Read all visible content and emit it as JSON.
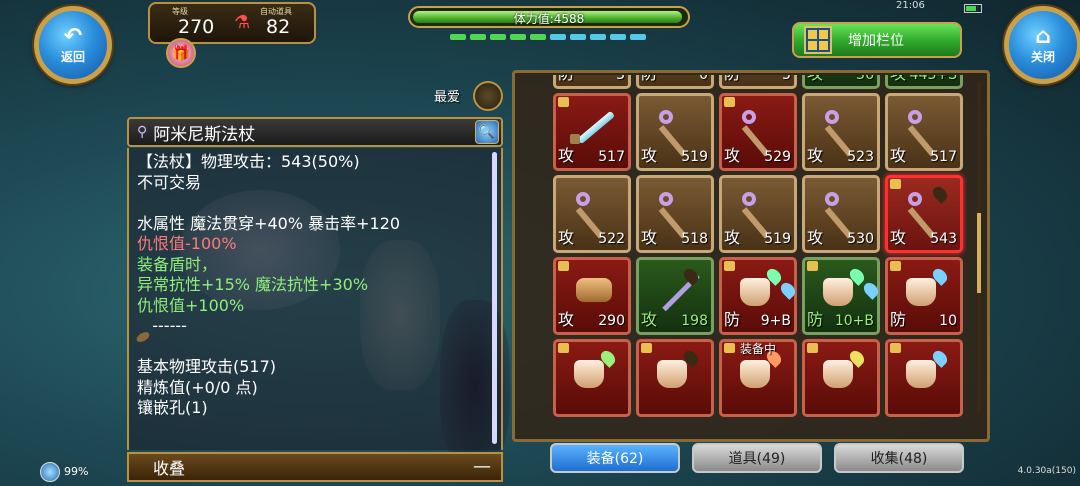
{
  "nav": {
    "back_label": "返回",
    "close_label": "关闭"
  },
  "status": {
    "level_label": "等级",
    "level_value": "270",
    "potion_label": "自动道具",
    "potion_value": "82"
  },
  "stamina": {
    "text": "体力值:4588",
    "fill_fraction": 0.99
  },
  "energy_segments": [
    "#53d651",
    "#53d651",
    "#53d651",
    "#53d651",
    "#53d651",
    "#55c9e6",
    "#55c9e6",
    "#55c9e6",
    "#55c9e6",
    "#55c9e6"
  ],
  "system": {
    "time": "21:06"
  },
  "add_slot": {
    "label": "增加栏位"
  },
  "favorite": {
    "label": "最爱"
  },
  "item": {
    "name": "阿米尼斯法杖",
    "details": [
      {
        "text": "【法杖】物理攻击：543(50%)",
        "color": "white"
      },
      {
        "text": "不可交易",
        "color": "white"
      },
      {
        "text": "",
        "color": "white"
      },
      {
        "text": "水属性 魔法贯穿+40% 暴击率+120",
        "color": "white"
      },
      {
        "text": "仇恨值-100%",
        "color": "red"
      },
      {
        "text": "装备盾时，",
        "color": "green"
      },
      {
        "text": "异常抗性+15% 魔法抗性+30%",
        "color": "green"
      },
      {
        "text": "仇恨值+100%",
        "color": "green"
      },
      {
        "text": "   ------",
        "color": "white"
      },
      {
        "text": "",
        "color": "white"
      },
      {
        "text": "基本物理攻击(517)",
        "color": "white"
      },
      {
        "text": "精炼值(+0/0 点)",
        "color": "white"
      },
      {
        "text": "镶嵌孔(1)",
        "color": "white"
      }
    ],
    "collapse_label": "收叠",
    "collapse_symbol": "—"
  },
  "inventory": {
    "slots": [
      {
        "type": "防",
        "value": "3",
        "style": "normal",
        "icon": "ring",
        "gems": [
          "#7ad0ff",
          "#d080ff"
        ],
        "locked": false
      },
      {
        "type": "防",
        "value": "0",
        "style": "normal",
        "icon": "ring",
        "gems": [
          "#7ad0ff",
          "#d080ff"
        ],
        "locked": false
      },
      {
        "type": "防",
        "value": "5",
        "style": "normal",
        "icon": "ring",
        "gems": [
          "#7ad0ff",
          "#d080ff"
        ],
        "locked": false
      },
      {
        "type": "攻",
        "value": "56",
        "style": "green",
        "icon": "sword",
        "gems": [
          "#ff6060",
          "#7ad0ff"
        ],
        "locked": false
      },
      {
        "type": "攻",
        "value": "443+S",
        "style": "green",
        "icon": "sword",
        "gems": [
          "#ff6060"
        ],
        "locked": false
      },
      {
        "type": "攻",
        "value": "517",
        "style": "red",
        "icon": "sword",
        "gems": [],
        "locked": true
      },
      {
        "type": "攻",
        "value": "519",
        "style": "normal",
        "icon": "staff",
        "gems": [],
        "locked": false
      },
      {
        "type": "攻",
        "value": "529",
        "style": "red",
        "icon": "staff",
        "gems": [],
        "locked": true
      },
      {
        "type": "攻",
        "value": "523",
        "style": "normal",
        "icon": "staff",
        "gems": [],
        "locked": false
      },
      {
        "type": "攻",
        "value": "517",
        "style": "normal",
        "icon": "staff",
        "gems": [],
        "locked": false
      },
      {
        "type": "攻",
        "value": "522",
        "style": "normal",
        "icon": "staff",
        "gems": [],
        "locked": false
      },
      {
        "type": "攻",
        "value": "518",
        "style": "normal",
        "icon": "staff",
        "gems": [],
        "locked": false
      },
      {
        "type": "攻",
        "value": "519",
        "style": "normal",
        "icon": "staff",
        "gems": [],
        "locked": false
      },
      {
        "type": "攻",
        "value": "530",
        "style": "normal",
        "icon": "staff",
        "gems": [],
        "locked": false
      },
      {
        "type": "攻",
        "value": "543",
        "style": "sel",
        "icon": "staff",
        "gems": [
          "#3a2a14"
        ],
        "locked": true
      },
      {
        "type": "攻",
        "value": "290",
        "style": "red",
        "icon": "gauntlet",
        "gems": [],
        "locked": true
      },
      {
        "type": "攻",
        "value": "198",
        "style": "green",
        "icon": "katana",
        "gems": [
          "#3a2a14"
        ],
        "locked": false
      },
      {
        "type": "防",
        "value": "9+B",
        "style": "red",
        "icon": "armor",
        "gems": [
          "#7affb0",
          "#7ad0ff"
        ],
        "locked": true
      },
      {
        "type": "防",
        "value": "10+B",
        "style": "green",
        "icon": "armor",
        "gems": [
          "#7affb0",
          "#7ad0ff"
        ],
        "locked": true
      },
      {
        "type": "防",
        "value": "10",
        "style": "red",
        "icon": "armor",
        "gems": [
          "#7ad0ff"
        ],
        "locked": true
      },
      {
        "type": "",
        "value": "",
        "style": "red",
        "icon": "armor",
        "gems": [
          "#9af07a"
        ],
        "locked": true
      },
      {
        "type": "",
        "value": "",
        "style": "red",
        "icon": "armor",
        "gems": [
          "#3a2a14"
        ],
        "locked": true
      },
      {
        "type": "",
        "value": "",
        "style": "red",
        "icon": "armor",
        "gems": [
          "#ff9a60"
        ],
        "locked": true,
        "equipped_label": "装备中"
      },
      {
        "type": "",
        "value": "",
        "style": "red",
        "icon": "armor",
        "gems": [
          "#f0e060"
        ],
        "locked": true
      },
      {
        "type": "",
        "value": "",
        "style": "red",
        "icon": "armor",
        "gems": [
          "#7ad0ff"
        ],
        "locked": true
      }
    ]
  },
  "tabs": [
    {
      "label": "装备(62)",
      "active": true
    },
    {
      "label": "道具(49)",
      "active": false
    },
    {
      "label": "收集(48)",
      "active": false
    }
  ],
  "footer": {
    "percent": "99%",
    "version": "4.0.30a(150)"
  },
  "colors": {
    "accent_gold": "#c9a14a",
    "tab_active": "#1f6fd0",
    "stamina_green": "#4caf2a"
  }
}
